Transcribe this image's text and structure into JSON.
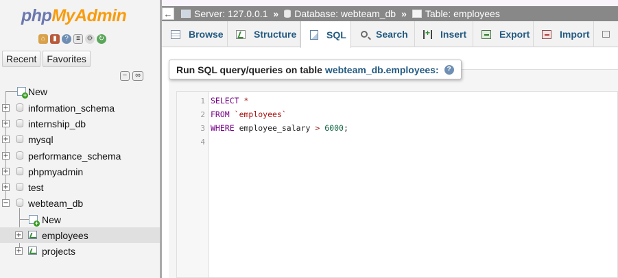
{
  "logo": {
    "part1": "php",
    "part2": "MyAdmin"
  },
  "quick_icons": [
    "home-icon",
    "logout-icon",
    "help-icon",
    "docs-icon",
    "settings-icon",
    "reload-icon"
  ],
  "nav_tabs": {
    "recent": "Recent",
    "favorites": "Favorites"
  },
  "tree": {
    "new": "New",
    "databases": [
      "information_schema",
      "internship_db",
      "mysql",
      "performance_schema",
      "phpmyadmin",
      "test",
      "webteam_db"
    ],
    "webteam_children": {
      "new": "New",
      "tables": [
        "employees",
        "projects"
      ]
    }
  },
  "breadcrumb": {
    "server": "Server: 127.0.0.1",
    "database": "Database: webteam_db",
    "table": "Table: employees",
    "separator": "»"
  },
  "tabs": [
    {
      "label": "Browse",
      "icon": "browse-icon"
    },
    {
      "label": "Structure",
      "icon": "structure-icon"
    },
    {
      "label": "SQL",
      "icon": "sql-icon"
    },
    {
      "label": "Search",
      "icon": "search-icon"
    },
    {
      "label": "Insert",
      "icon": "insert-icon"
    },
    {
      "label": "Export",
      "icon": "export-icon"
    },
    {
      "label": "Import",
      "icon": "import-icon"
    }
  ],
  "sql_panel": {
    "heading": "Run SQL query/queries on table",
    "table_name": "webteam_db.employees:",
    "help": "?"
  },
  "editor": {
    "line_numbers": [
      "1",
      "2",
      "3",
      "4"
    ],
    "lines": {
      "l1_kw": "SELECT",
      "l1_op": "*",
      "l2_kw": "FROM",
      "l2_str": "`employees`",
      "l3_kw": "WHERE",
      "l3_col": "employee_salary",
      "l3_op": ">",
      "l3_num": "6000",
      "l3_end": ";"
    }
  },
  "colors": {
    "link": "#235a81",
    "crumb_bg": "#888888",
    "logo_php": "#6c78af",
    "logo_admin": "#f89c0e"
  }
}
